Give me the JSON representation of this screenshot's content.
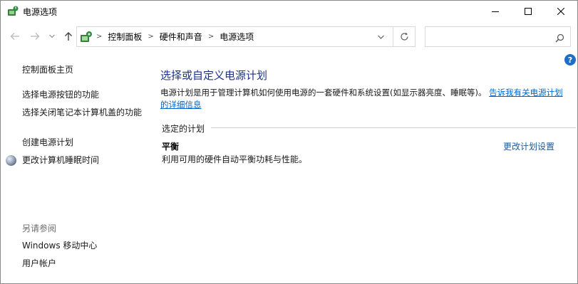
{
  "window": {
    "title": "电源选项"
  },
  "address": {
    "crumbs": [
      "控制面板",
      "硬件和声音",
      "电源选项"
    ],
    "search_placeholder": ""
  },
  "left": {
    "home": "控制面板主页",
    "buttons": "选择电源按钮的功能",
    "lid": "选择关闭笔记本计算机盖的功能",
    "create": "创建电源计划",
    "sleep": "更改计算机睡眠时间",
    "see_also": "另请参阅",
    "mobility": "Windows 移动中心",
    "accounts": "用户帐户"
  },
  "main": {
    "title": "选择或自定义电源计划",
    "desc_text": "电源计划是用于管理计算机如何使用电源的一套硬件和系统设置(如显示器亮度、睡眠等)。",
    "desc_link": "告诉我有关电源计划的详细信息",
    "section_label": "选定的计划",
    "plan_name": "平衡",
    "plan_desc": "利用可用的硬件自动平衡功耗与性能。",
    "plan_settings": "更改计划设置"
  },
  "help_label": "?",
  "colors": {
    "heading": "#1e3287",
    "link": "#0066cc",
    "help": "#1f6fc5"
  }
}
